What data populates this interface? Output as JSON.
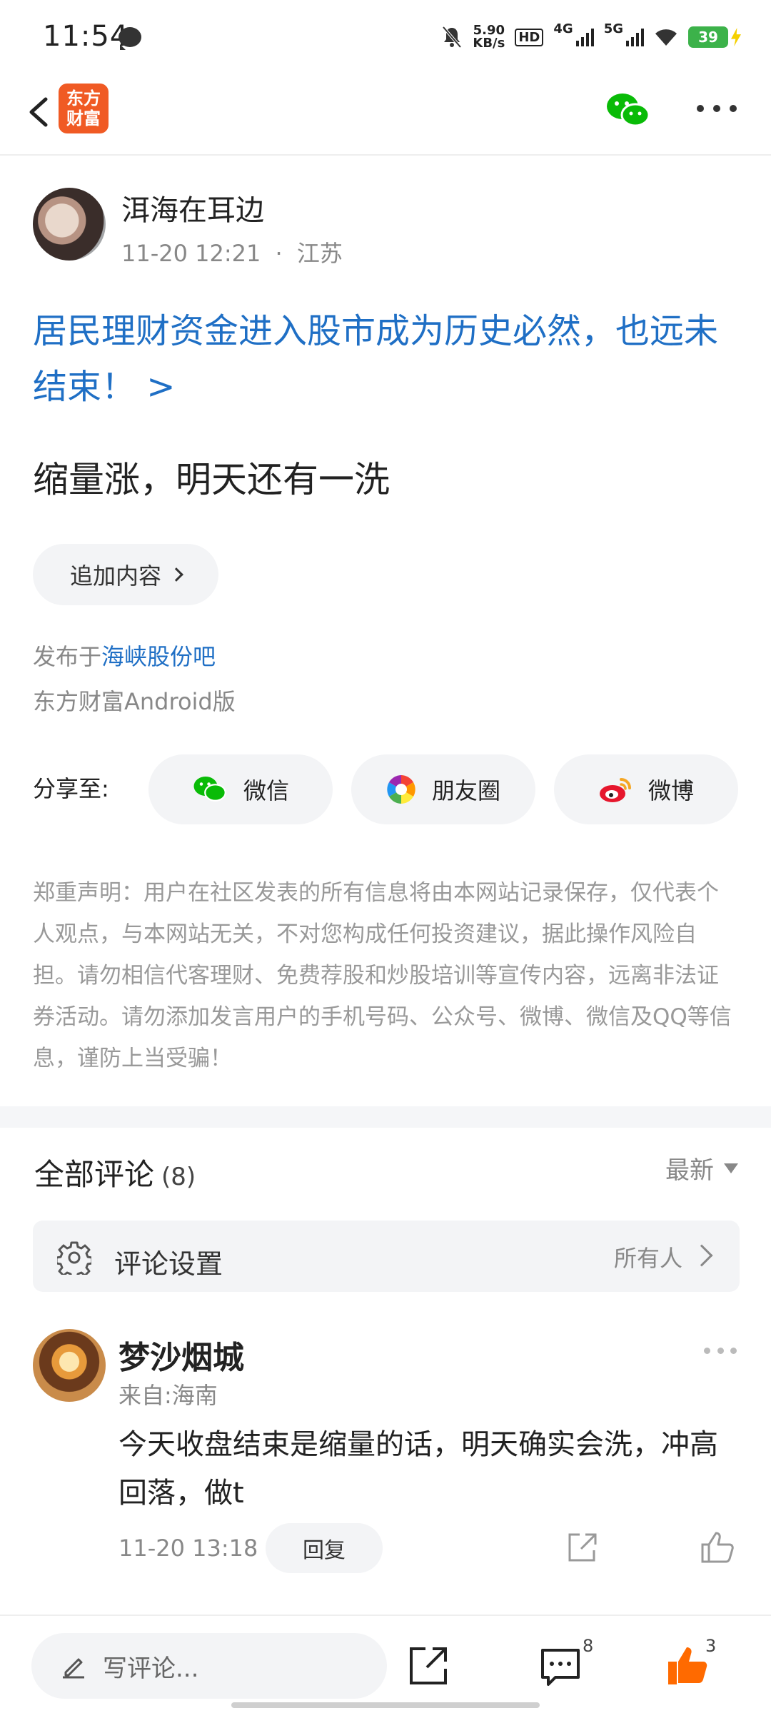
{
  "status_bar": {
    "time": "11:54",
    "net_speed_value": "5.90",
    "net_speed_unit": "KB/s",
    "hd": "HD",
    "net_4g": "4G",
    "net_5g": "5G",
    "battery": "39"
  },
  "header": {
    "logo_line1": "东方",
    "logo_line2": "财富"
  },
  "post": {
    "author_name": "洱海在耳边",
    "date": "11-20 12:21",
    "location": "江苏",
    "topic_title": "居民理财资金进入股市成为历史必然，也远未结束！ >",
    "body": "缩量涨，明天还有一洗",
    "add_content_label": "追加内容",
    "published_prefix": "发布于",
    "published_bar": "海峡股份吧",
    "client": "东方财富Android版"
  },
  "share": {
    "label": "分享至:",
    "wechat": "微信",
    "moments": "朋友圈",
    "weibo": "微博"
  },
  "disclaimer": "郑重声明：用户在社区发表的所有信息将由本网站记录保存，仅代表个人观点，与本网站无关，不对您构成任何投资建议，据此操作风险自担。请勿相信代客理财、免费荐股和炒股培训等宣传内容，远离非法证券活动。请勿添加发言用户的手机号码、公众号、微博、微信及QQ等信息，谨防上当受骗！",
  "comments": {
    "title": "全部评论",
    "count": "(8)",
    "sort_label": "最新",
    "settings_label": "评论设置",
    "settings_value": "所有人",
    "items": [
      {
        "name": "梦沙烟城",
        "from": "来自:海南",
        "text": "今天收盘结束是缩量的话，明天确实会洗，冲高回落，做t",
        "time": "11-20 13:18",
        "reply_label": "回复"
      }
    ]
  },
  "bottom_bar": {
    "write_placeholder": "写评论...",
    "comment_count": "8",
    "like_count": "3"
  },
  "colors": {
    "accent_blue": "#1f6fc5",
    "brand_orange": "#f05a24",
    "wechat_green": "#09bb07",
    "like_orange": "#ff6a00"
  },
  "icons": [
    "back-icon",
    "wechat-icon",
    "more-icon",
    "chevron-right-icon",
    "moments-icon",
    "weibo-icon",
    "gear-icon",
    "share-icon",
    "like-icon",
    "pencil-icon",
    "comment-icon"
  ]
}
